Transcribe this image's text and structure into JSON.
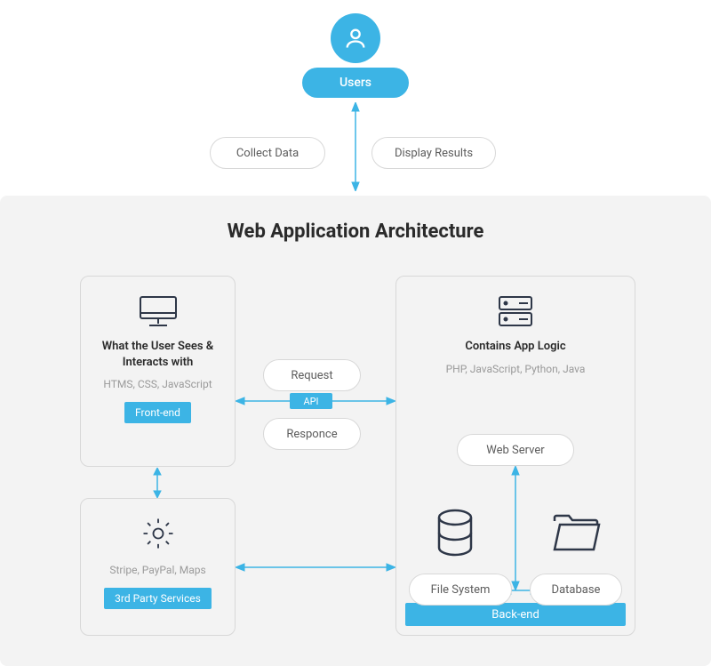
{
  "top": {
    "users_label": "Users",
    "collect_data": "Collect Data",
    "display_results": "Display Results"
  },
  "main": {
    "title": "Web Application Architecture",
    "frontend": {
      "title": "What the User Sees & Interacts with",
      "sub": "HTMS, CSS, JavaScript",
      "tag": "Front-end"
    },
    "backend": {
      "title": "Contains App Logic",
      "sub": "PHP, JavaScript, Python, Java",
      "web_server": "Web Server",
      "file_system": "File System",
      "database": "Database",
      "tag": "Back-end"
    },
    "thirdparty": {
      "sub": "Stripe, PayPal, Maps",
      "tag": "3rd Party Services"
    },
    "middle": {
      "request": "Request",
      "response": "Responce",
      "api": "API"
    }
  }
}
